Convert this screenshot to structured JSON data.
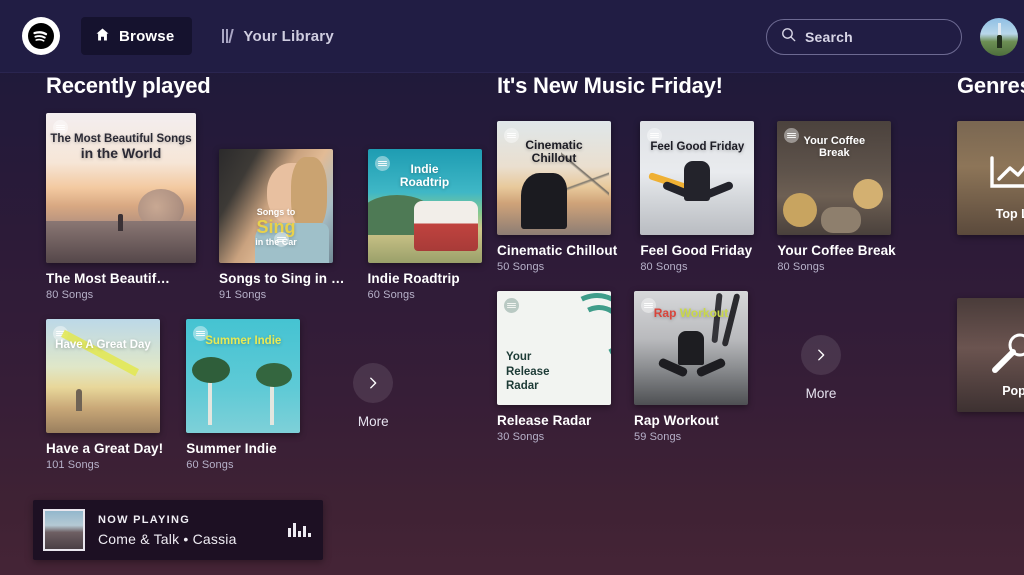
{
  "header": {
    "logo_icon": "spotify-logo-icon",
    "browse": {
      "label": "Browse",
      "icon": "home-icon"
    },
    "library": {
      "label": "Your Library",
      "icon": "library-icon"
    },
    "search": {
      "placeholder": "Search",
      "icon": "search-icon"
    },
    "avatar_icon": "user-avatar"
  },
  "sections": [
    {
      "title": "Recently played",
      "more_label": "More",
      "rows": [
        [
          {
            "title": "The Most Beautif…",
            "songs": "80 Songs",
            "overlay": "The Most Beautiful Songs\nin the World",
            "featured": true
          },
          {
            "title": "Songs to Sing in …",
            "songs": "91 Songs",
            "overlay": "Songs to\nSing\nin the Car"
          },
          {
            "title": "Indie Roadtrip",
            "songs": "60 Songs",
            "overlay": "Indie\nRoadtrip"
          }
        ],
        [
          {
            "title": "Have a Great Day!",
            "songs": "101 Songs",
            "overlay": "Have A Great Day"
          },
          {
            "title": "Summer Indie",
            "songs": "60 Songs",
            "overlay": "Summer Indie"
          }
        ]
      ]
    },
    {
      "title": "It's New Music Friday!",
      "more_label": "More",
      "rows": [
        [
          {
            "title": "Cinematic Chillout",
            "songs": "50 Songs",
            "overlay": "Cinematic\nChillout"
          },
          {
            "title": "Feel Good Friday",
            "songs": "80 Songs",
            "overlay": "Feel Good Friday"
          },
          {
            "title": "Your Coffee Break",
            "songs": "80 Songs",
            "overlay": "Your Coffee\nBreak"
          }
        ],
        [
          {
            "title": "Release Radar",
            "songs": "30 Songs",
            "overlay": "Your\nRelease\nRadar"
          },
          {
            "title": "Rap Workout",
            "songs": "59 Songs",
            "overlay": "Rap Workout"
          }
        ]
      ]
    },
    {
      "title": "Genres",
      "rows": [
        [
          {
            "title": "Top Li",
            "overlay": "Top Li"
          }
        ],
        [
          {
            "title": "Pop",
            "overlay": "Pop"
          }
        ]
      ]
    }
  ],
  "now_playing": {
    "kicker": "NOW PLAYING",
    "song": "Come & Talk • Cassia",
    "eq_icon": "equalizer-icon",
    "thumb_icon": "album-thumbnail"
  },
  "colors": {
    "bg_top": "#1b1838",
    "bg_bottom": "#452436",
    "header": "#211d44",
    "browse_bg": "#15122e",
    "now_playing_bg": "#1d1023"
  }
}
